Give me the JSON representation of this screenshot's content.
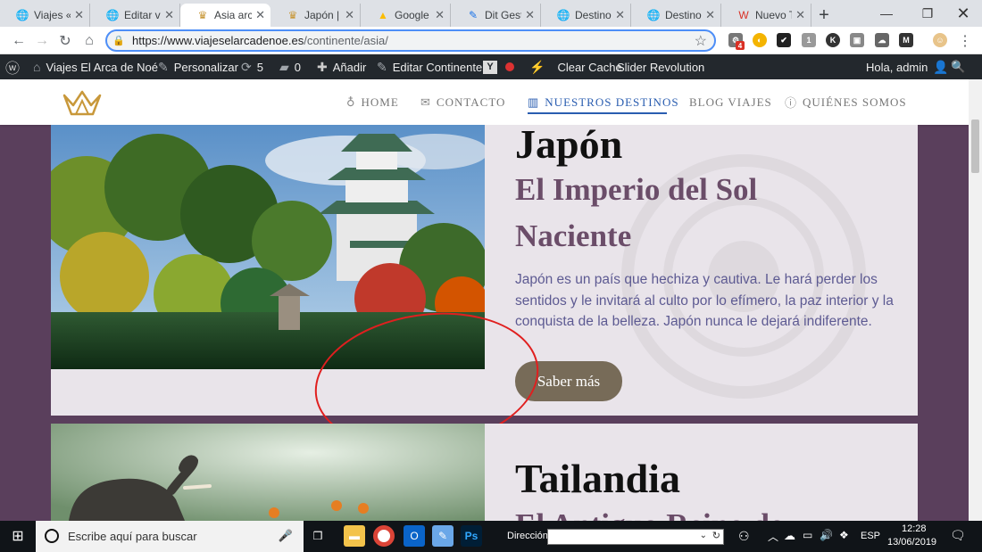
{
  "browser": {
    "tabs": [
      {
        "title": "Viajes « Vi",
        "icon": "globe-icon"
      },
      {
        "title": "Editar viaj",
        "icon": "globe-icon"
      },
      {
        "title": "Asia archi",
        "icon": "crown-icon"
      },
      {
        "title": "Japón | Vi",
        "icon": "crown-icon"
      },
      {
        "title": "Google A",
        "icon": "google-ads-icon"
      },
      {
        "title": "Dit Gestic",
        "icon": "pencil-icon"
      },
      {
        "title": "Destino A",
        "icon": "globe-icon"
      },
      {
        "title": "Destino A",
        "icon": "globe-icon"
      },
      {
        "title": "Nuevo Te",
        "icon": "red-w-icon"
      }
    ],
    "active_tab_index": 2,
    "url_host": "https://www.viajeselarcadenoe.es",
    "url_path": "/continente/asia/",
    "extension_badge": "4"
  },
  "wp_admin_bar": {
    "site_name": "Viajes El Arca de Noé",
    "customize": "Personalizar",
    "updates": "5",
    "comments": "0",
    "add_new": "Añadir",
    "edit": "Editar Continente",
    "clear_cache": "Clear Cache",
    "slider": "Slider Revolution",
    "greeting": "Hola, admin"
  },
  "site_nav": {
    "items": [
      "HOME",
      "CONTACTO",
      "NUESTROS DESTINOS",
      "BLOG VIAJES",
      "QUIÉNES SOMOS"
    ],
    "active_index": 2
  },
  "destinations": [
    {
      "name": "Japón",
      "subtitle": "El Imperio del Sol Naciente",
      "description": "Japón es un país que hechiza y cautiva. Le hará perder los sentidos y le invitará al culto por lo efímero, la paz interior y la conquista de la belleza. Japón nunca le dejará indiferente.",
      "button": "Saber más"
    },
    {
      "name": "Tailandia",
      "subtitle": "El Antiguo Reino de"
    }
  ],
  "taskbar": {
    "search_placeholder": "Escribe aquí para buscar",
    "address_label": "Dirección",
    "language": "ESP",
    "time": "12:28",
    "date": "13/06/2019"
  },
  "colors": {
    "page_background": "#5a3f5c",
    "card_background": "#e9e4ea",
    "button": "#776b58",
    "nav_active": "#2a5db0",
    "annotation": "#e01f1f"
  }
}
